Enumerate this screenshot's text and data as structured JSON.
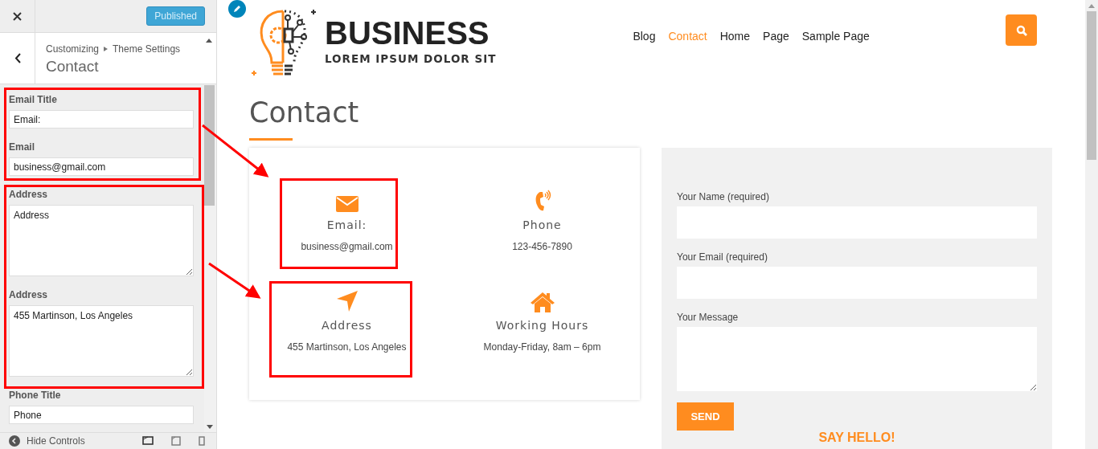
{
  "customizer": {
    "publish_button": "Published",
    "breadcrumb": [
      "Customizing",
      "Theme Settings"
    ],
    "section_title": "Contact",
    "fields": [
      {
        "kind": "input",
        "label": "Email Title",
        "value": "Email:"
      },
      {
        "kind": "input",
        "label": "Email",
        "value": "business@gmail.com"
      },
      {
        "kind": "textarea",
        "label": "Address",
        "value": "Address"
      },
      {
        "kind": "textarea",
        "label": "Address",
        "value": "455 Martinson, Los Angeles"
      },
      {
        "kind": "input",
        "label": "Phone Title",
        "value": "Phone"
      }
    ],
    "footer": "Hide Controls"
  },
  "site": {
    "logo": {
      "title": "BUSINESS",
      "tagline": "LOREM IPSUM DOLOR SIT"
    },
    "nav": [
      {
        "label": "Blog",
        "selected": false
      },
      {
        "label": "Contact",
        "selected": true
      },
      {
        "label": "Home",
        "selected": false
      },
      {
        "label": "Page",
        "selected": false
      },
      {
        "label": "Sample Page",
        "selected": false
      }
    ],
    "page_title": "Contact",
    "contact_items": [
      {
        "kind": "email",
        "title": "Email:",
        "value": "business@gmail.com"
      },
      {
        "kind": "phone",
        "title": "Phone",
        "value": "123-456-7890"
      },
      {
        "kind": "address",
        "title": "Address",
        "value": "455 Martinson, Los Angeles"
      },
      {
        "kind": "hours",
        "title": "Working Hours",
        "value": "Monday-Friday, 8am – 6pm"
      }
    ],
    "form": {
      "fields": [
        {
          "kind": "input",
          "label": "Your Name (required)"
        },
        {
          "kind": "input",
          "label": "Your Email (required)"
        },
        {
          "kind": "textarea",
          "label": "Your Message"
        }
      ],
      "button": "SEND",
      "heading": "SAY HELLO!"
    }
  }
}
